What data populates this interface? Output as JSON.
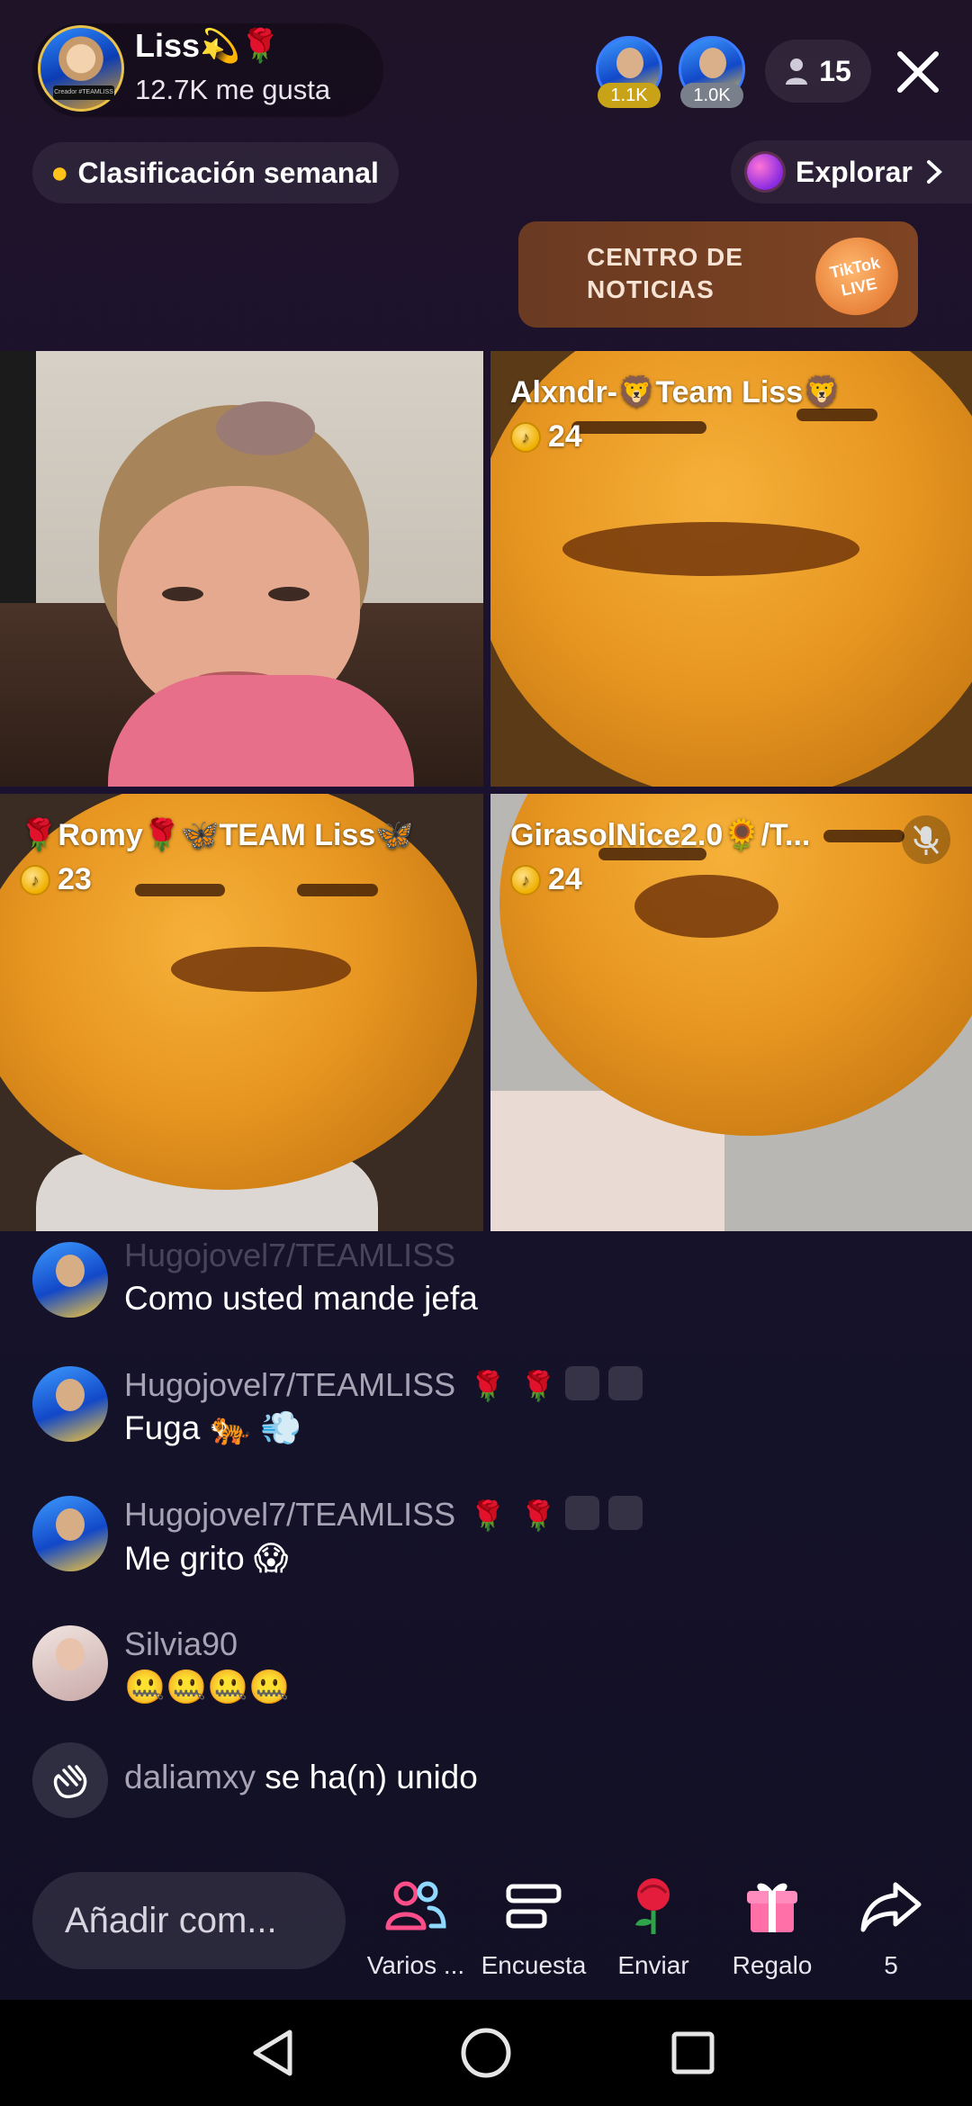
{
  "host": {
    "name": "Liss💫🌹",
    "likes": "12.7K me gusta",
    "avatar_tag": "Creador #TEAMLISS"
  },
  "top_viewers": [
    {
      "badge": "1.1K",
      "badge_color": "#c8a217"
    },
    {
      "badge": "1.0K",
      "badge_color": "#7a7f8c"
    }
  ],
  "viewer_count": "15",
  "weekly_ranking": "Clasificación semanal",
  "explore": "Explorar",
  "news_banner": {
    "text": "CENTRO DE NOTICIAS",
    "logo": "TikTok LIVE"
  },
  "guests": [
    {
      "name": "Alxndr-🦁Team Liss🦁",
      "coins": "24"
    },
    {
      "name": "🌹Romy🌹🦋TEAM Liss🦋",
      "coins": "23"
    },
    {
      "name": "GirasolNice2.0🌻/T...",
      "coins": "24",
      "muted": true
    }
  ],
  "chat": [
    {
      "user": "Hugojovel7/TEAMLISS",
      "text": "Como usted mande jefa"
    },
    {
      "user": "Hugojovel7/TEAMLISS",
      "text": "Fuga 🐅 💨"
    },
    {
      "user": "Hugojovel7/TEAMLISS",
      "text": "Me grito 😱"
    },
    {
      "user": "Silvia90",
      "text": "🤐🤐🤐🤐"
    }
  ],
  "join_notice": {
    "user": "daliamxy",
    "text": "se ha(n) unido"
  },
  "bottom_bar": {
    "comment_placeholder": "Añadir com...",
    "actions": [
      "Varios ...",
      "Encuesta",
      "Enviar",
      "Regalo",
      "5"
    ]
  },
  "colors": {
    "accent_pink": "#ff4f8b",
    "rose": "#d81b3a",
    "gift": "#ff6fa8"
  }
}
